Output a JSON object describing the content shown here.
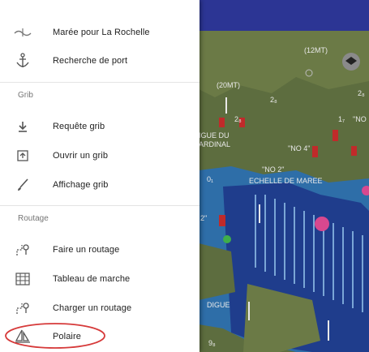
{
  "drawer": {
    "items": [
      {
        "label": "Marée pour La Rochelle",
        "icon": "tide-icon"
      },
      {
        "label": "Recherche de port",
        "icon": "anchor-icon"
      },
      {
        "label": "Requête grib",
        "icon": "download-icon"
      },
      {
        "label": "Ouvrir un grib",
        "icon": "open-file-icon"
      },
      {
        "label": "Affichage grib",
        "icon": "brush-icon"
      },
      {
        "label": "Faire un routage",
        "icon": "route-icon"
      },
      {
        "label": "Tableau de marche",
        "icon": "table-icon"
      },
      {
        "label": "Charger un routage",
        "icon": "load-route-icon"
      },
      {
        "label": "Polaire",
        "icon": "sail-icon"
      }
    ],
    "sections": {
      "grib": "Grib",
      "routage": "Routage"
    }
  },
  "map": {
    "labels": {
      "depth_12mt": "(12MT)",
      "depth_20mt": "(20MT)",
      "digue_du": "IGUE DU",
      "cardinal": "ARDINAL",
      "no4": "\"NO 4\"",
      "no2": "\"NO 2\"",
      "echelle": "ECHELLE DE MAREE",
      "digue": "DIGUE",
      "depth_2a": "2₈",
      "depth_2b": "2₈",
      "depth_2c": "2₈",
      "depth_17": "1₇",
      "quote_no": "\"NO",
      "depth_0a": "0₁",
      "depth_9": "9₈",
      "quote_2": "2\""
    },
    "colors": {
      "land": "#5a6a3c",
      "water": "#2e6ea8",
      "deep_water": "#1f3d8c",
      "marina": "#5c8fc6"
    }
  },
  "annotation": {
    "color": "#d63a3a"
  }
}
